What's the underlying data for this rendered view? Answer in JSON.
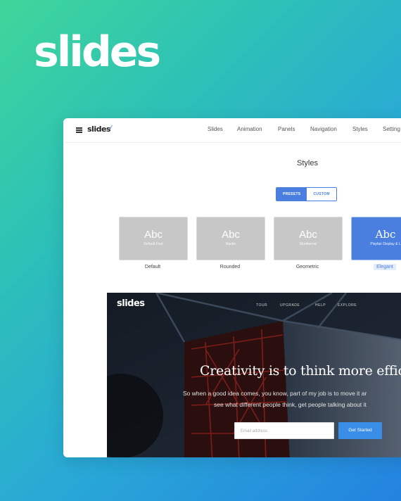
{
  "brand": {
    "wordmark": "slides"
  },
  "app": {
    "logo": "slides",
    "nav": [
      "Slides",
      "Animation",
      "Panels",
      "Navigation",
      "Styles",
      "Setting"
    ]
  },
  "styles": {
    "title": "Styles",
    "segments": {
      "presets": "PRESETS",
      "custom": "CUSTOM",
      "active": "presets"
    },
    "cards": [
      {
        "sample": "Abc",
        "font": "Default Font",
        "label": "Default"
      },
      {
        "sample": "Abc",
        "font": "Nunito",
        "label": "Rounded"
      },
      {
        "sample": "Abc",
        "font": "Montserrat",
        "label": "Geometric"
      },
      {
        "sample": "Abc",
        "font": "Playfair Display & L",
        "label": "Elegant",
        "selected": true
      }
    ]
  },
  "preview": {
    "logo": "slides",
    "nav": [
      "TOUR",
      "UPGRADE",
      "HELP",
      "EXPLORE"
    ],
    "headline": "Creativity is to think more efficien",
    "sub1": "So when a good idea comes, you know, part of my job is to move it ar",
    "sub2": "see what different people think, get people talking about it",
    "input_placeholder": "Email address",
    "cta": "Get Started"
  },
  "colors": {
    "accent": "#4a7fe0",
    "gradient_start": "#3fd69a",
    "gradient_end": "#2383e0"
  }
}
